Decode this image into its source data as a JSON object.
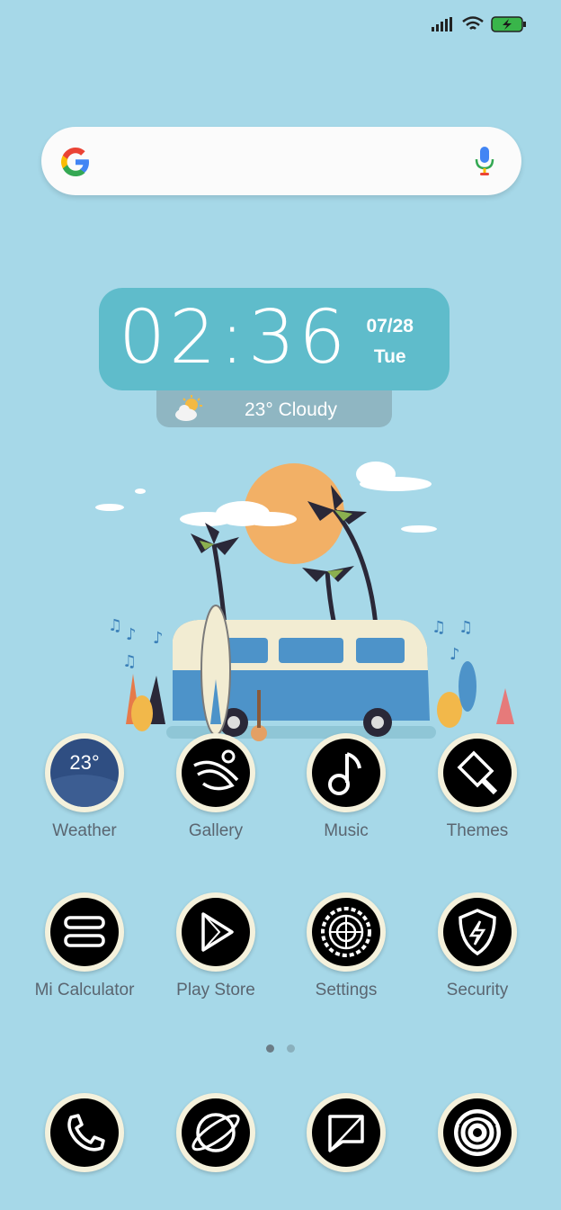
{
  "status_bar": {
    "icons": [
      "signal-icon",
      "wifi-icon",
      "battery-charging-icon"
    ],
    "battery_color": "#39b54a"
  },
  "search": {
    "logo": "google-logo",
    "mic": "mic-icon"
  },
  "clock": {
    "time": "02:36",
    "date": "07/28",
    "day": "Tue",
    "weather": "23° Cloudy",
    "weather_icon": "partly-cloudy-icon"
  },
  "apps": [
    {
      "label": "Weather",
      "icon": "weather-icon",
      "value": "23°"
    },
    {
      "label": "Gallery",
      "icon": "gallery-icon"
    },
    {
      "label": "Music",
      "icon": "music-note-icon"
    },
    {
      "label": "Themes",
      "icon": "paintbrush-icon"
    },
    {
      "label": "Mi Calculator",
      "icon": "calculator-icon"
    },
    {
      "label": "Play Store",
      "icon": "play-store-icon"
    },
    {
      "label": "Settings",
      "icon": "gear-icon"
    },
    {
      "label": "Security",
      "icon": "shield-bolt-icon"
    }
  ],
  "dock": [
    {
      "icon": "phone-icon"
    },
    {
      "icon": "browser-icon"
    },
    {
      "icon": "messages-icon"
    },
    {
      "icon": "camera-icon"
    }
  ],
  "page_indicator": {
    "pages": 2,
    "current": 1
  },
  "colors": {
    "background": "#a6d8e8",
    "clock_widget": "#5fbccb",
    "icon_ring": "#f4f1dc"
  }
}
